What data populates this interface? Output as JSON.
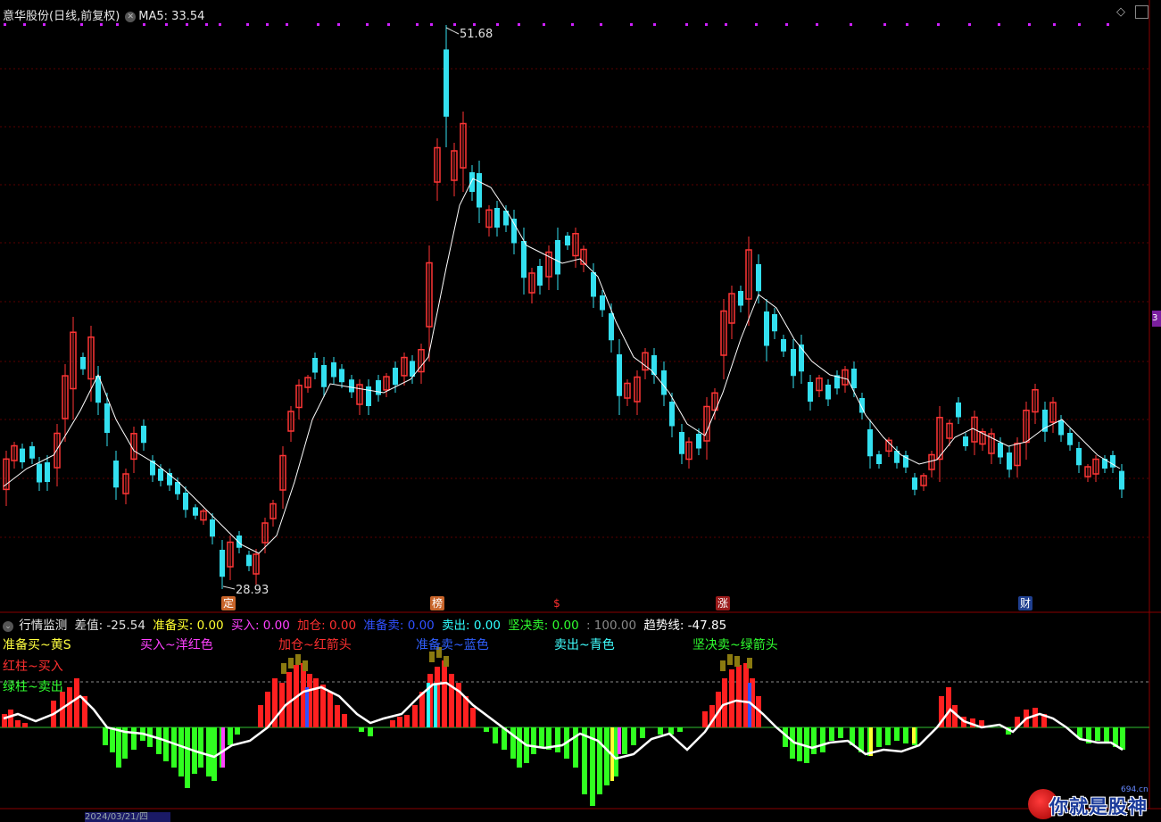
{
  "price_panel": {
    "stock_title": "意华股份(日线,前复权)",
    "ma_label": "MA5: 33.54",
    "high_label": "51.68",
    "low_label": "28.93",
    "event_badges": [
      {
        "text": "定",
        "color": "#c8642a",
        "text_color": "#ffffff"
      },
      {
        "text": "榜",
        "color": "#c8642a",
        "text_color": "#ffffff"
      },
      {
        "text": "$",
        "color": "#000000",
        "text_color": "#ff3030"
      },
      {
        "text": "涨",
        "color": "#9a1a1a",
        "text_color": "#ffffff"
      },
      {
        "text": "财",
        "color": "#1f3f8f",
        "text_color": "#ffffff"
      }
    ],
    "right_edge_tag": "3",
    "colors": {
      "up": "#ff3535",
      "down": "#33e0f0",
      "ma_line": "#ffffff",
      "marker": "#d020ff"
    }
  },
  "indicator_panel": {
    "name": "行情监测",
    "values": [
      {
        "label": "差值: -25.54",
        "color": "#e0e0e0"
      },
      {
        "label": "准备买: 0.00",
        "color": "#ffff30"
      },
      {
        "label": "买入: 0.00",
        "color": "#ff40ff"
      },
      {
        "label": "加仓: 0.00",
        "color": "#ff3030"
      },
      {
        "label": "准备卖: 0.00",
        "color": "#3050ff"
      },
      {
        "label": "卖出: 0.00",
        "color": "#30ffff"
      },
      {
        "label": "坚决卖: 0.00",
        "color": "#30ff30"
      },
      {
        "label": ": 100.00",
        "color": "#888888"
      },
      {
        "label": "趋势线: -47.85",
        "color": "#ffffff"
      }
    ],
    "legends": [
      {
        "text": "准备买~黄S",
        "color": "#ffff40"
      },
      {
        "text": "买入~洋红色",
        "color": "#ff40ff"
      },
      {
        "text": "加仓~红箭头",
        "color": "#ff3030"
      },
      {
        "text": "准备卖~蓝色",
        "color": "#3060ff"
      },
      {
        "text": "卖出~青色",
        "color": "#40ffff"
      },
      {
        "text": "坚决卖~绿箭头",
        "color": "#30ff30"
      },
      {
        "text": "红柱~买入",
        "color": "#ff3030"
      },
      {
        "text": "绿柱~卖出",
        "color": "#30ff30"
      }
    ]
  },
  "status_bar": {
    "date_text": "2024/03/21/四"
  },
  "watermark": {
    "text": "你就是股神",
    "site": "694.cn"
  }
}
